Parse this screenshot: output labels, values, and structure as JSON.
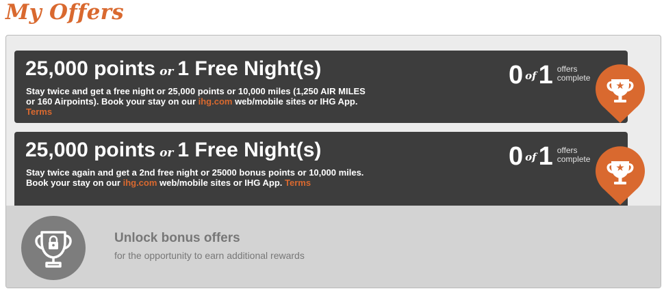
{
  "page_title": "My Offers",
  "offers": [
    {
      "reward_a": "25,000 points",
      "or_word": "or",
      "reward_b": "1 Free Night(s)",
      "desc_text": "Stay twice and get a free night or 25,000 points or 10,000 miles (1,250 AIR MILES or 160 Airpoints). Book your stay on our ",
      "link_text": "ihg.com",
      "desc_text_2": " web/mobile sites or IHG App. ",
      "terms_label": "Terms",
      "completed": "0",
      "of_word": "of",
      "total": "1",
      "progress_label_1": "offers",
      "progress_label_2": "complete"
    },
    {
      "reward_a": "25,000 points",
      "or_word": "or",
      "reward_b": "1 Free Night(s)",
      "desc_text": "Stay twice again and get a 2nd free night or 25000 bonus points or 10,000 miles. Book your stay on our ",
      "link_text": "ihg.com",
      "desc_text_2": " web/mobile sites or IHG App. ",
      "terms_label": "Terms",
      "completed": "0",
      "of_word": "of",
      "total": "1",
      "progress_label_1": "offers",
      "progress_label_2": "complete"
    }
  ],
  "bonus": {
    "title": "Unlock bonus offers",
    "subtitle": "for the opportunity to earn additional rewards",
    "icon": "locked-trophy-icon"
  },
  "icons": {
    "offer_pin": "trophy-star-icon"
  },
  "colors": {
    "accent": "#d9692f",
    "card_bg": "#3d3d3d",
    "panel_bg": "#ececec",
    "bonus_bg": "#d3d3d3",
    "bonus_badge": "#7d7d7d"
  }
}
